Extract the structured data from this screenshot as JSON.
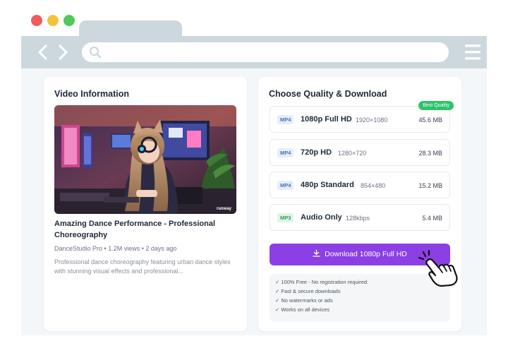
{
  "window": {
    "controls": [
      "close",
      "minimize",
      "maximize"
    ],
    "icons": [
      "back-arrow-icon",
      "forward-arrow-icon",
      "search-icon",
      "hamburger-menu-icon"
    ],
    "address": {
      "value": "",
      "placeholder": ""
    }
  },
  "video_info": {
    "heading": "Video Information",
    "thumbnail_watermark": "runway",
    "title": "Amazing Dance Performance - Professional Choreography",
    "channel": "DanceStudio Pro",
    "views": "1.2M views",
    "age": "2 days ago",
    "description": "Professional dance choreography featuring urban dance styles with stunning visual effects and professional..."
  },
  "download": {
    "heading": "Choose Quality & Download",
    "options": [
      {
        "format": "MP4",
        "quality": "1080p Full HD",
        "detail": "1920×1080",
        "size": "45.6 MB",
        "badge": "Best Quality"
      },
      {
        "format": "MP4",
        "quality": "720p HD",
        "detail": "1280×720",
        "size": "28.3 MB"
      },
      {
        "format": "MP4",
        "quality": "480p Standard",
        "detail": "854×480",
        "size": "15.2 MB"
      },
      {
        "format": "MP3",
        "quality": "Audio Only",
        "detail": "128kbps",
        "size": "5.4 MB"
      }
    ],
    "button_label": "Download 1080p Full HD",
    "features": [
      "✓ 100% Free - No registration required",
      "✓ Fast & secure downloads",
      "✓ No watermarks or ads",
      "✓ Works on all devices"
    ]
  },
  "colors": {
    "accent_purple": "#8b3fe4",
    "best_badge_green": "#2fc36b",
    "browser_chrome": "#cdd8de",
    "page_background": "#f4f7f9"
  }
}
